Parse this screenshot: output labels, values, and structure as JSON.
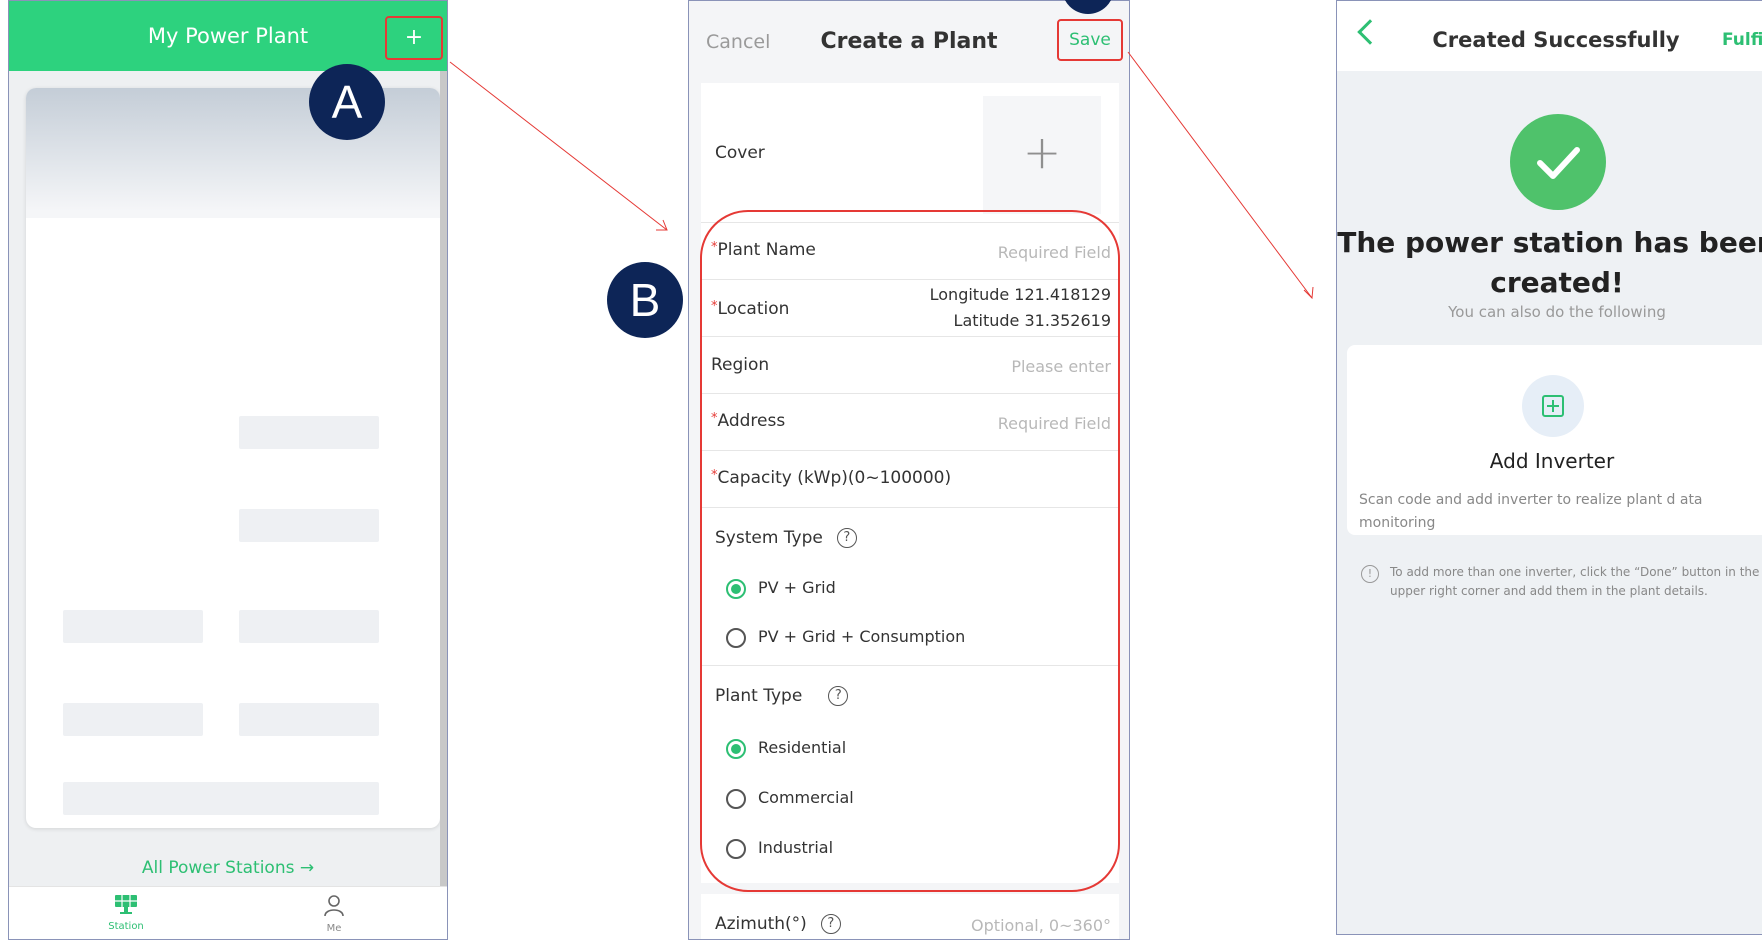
{
  "screen1": {
    "title": "My Power Plant",
    "add_button": "+",
    "all_stations_link": "All Power Stations",
    "arrow_glyph": "→",
    "tabs": [
      {
        "label": "Station",
        "icon": "solar-panel-icon",
        "active": true
      },
      {
        "label": "Me",
        "icon": "user-icon",
        "active": false
      }
    ],
    "accent_color": "#2dd27e"
  },
  "markers": {
    "a": "A",
    "b": "B"
  },
  "screen2": {
    "cancel": "Cancel",
    "title": "Create a Plant",
    "save": "Save",
    "cover": {
      "label": "Cover",
      "button": "+"
    },
    "fields": {
      "plant_name": {
        "required_mark": "*",
        "label": "Plant Name",
        "placeholder": "Required Field"
      },
      "location": {
        "required_mark": "*",
        "label": "Location",
        "longitude": "Longitude 121.418129",
        "latitude": "Latitude 31.352619"
      },
      "region": {
        "label": "Region",
        "placeholder": "Please enter"
      },
      "address": {
        "required_mark": "*",
        "label": "Address",
        "placeholder": "Required Field"
      },
      "capacity": {
        "required_mark": "*",
        "label": "Capacity (kWp)(0~100000)"
      }
    },
    "system_type": {
      "label": "System Type",
      "help": "?",
      "options": [
        {
          "label": "PV + Grid",
          "selected": true
        },
        {
          "label": "PV + Grid + Consumption",
          "selected": false
        }
      ]
    },
    "plant_type": {
      "label": "Plant Type",
      "help": "?",
      "options": [
        {
          "label": "Residential",
          "selected": true
        },
        {
          "label": "Commercial",
          "selected": false
        },
        {
          "label": "Industrial",
          "selected": false
        }
      ]
    },
    "azimuth": {
      "label": "Azimuth(°)",
      "help": "?",
      "placeholder": "Optional, 0~360°"
    }
  },
  "screen3": {
    "title": "Created Successfully",
    "fulfill": "Fulfill",
    "heading": "The power station has been created!",
    "subheading": "You can also do the following",
    "add_inverter": {
      "label": "Add Inverter",
      "description": "Scan code and add inverter to realize plant d ata monitoring"
    },
    "note_icon": "!",
    "note": "To add more than one inverter, click the “Done” button in the upper right corner and add them in the plant details."
  },
  "colors": {
    "accent": "#2dbf73",
    "highlight": "#e53935",
    "marker": "#0d2557"
  }
}
